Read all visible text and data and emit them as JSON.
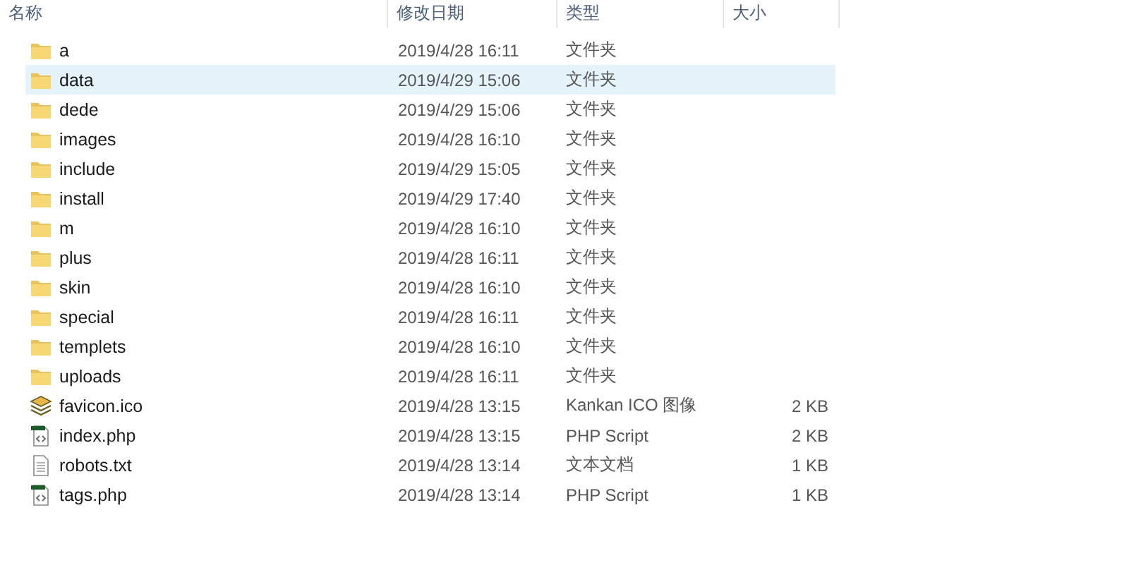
{
  "table": {
    "columns": [
      {
        "label": "名称"
      },
      {
        "label": "修改日期"
      },
      {
        "label": "类型"
      },
      {
        "label": "大小"
      }
    ],
    "rows": [
      {
        "kind": "folder",
        "name": "a",
        "modified": "2019/4/28 16:11",
        "type": "文件夹",
        "selected": false
      },
      {
        "kind": "folder",
        "name": "data",
        "modified": "2019/4/29 15:06",
        "type": "文件夹",
        "selected": true
      },
      {
        "kind": "folder",
        "name": "dede",
        "modified": "2019/4/29 15:06",
        "type": "文件夹",
        "selected": false
      },
      {
        "kind": "folder",
        "name": "images",
        "modified": "2019/4/28 16:10",
        "type": "文件夹",
        "selected": false
      },
      {
        "kind": "folder",
        "name": "include",
        "modified": "2019/4/29 15:05",
        "type": "文件夹",
        "selected": false
      },
      {
        "kind": "folder",
        "name": "install",
        "modified": "2019/4/29 17:40",
        "type": "文件夹",
        "selected": false
      },
      {
        "kind": "folder",
        "name": "m",
        "modified": "2019/4/28 16:10",
        "type": "文件夹",
        "selected": false
      },
      {
        "kind": "folder",
        "name": "plus",
        "modified": "2019/4/28 16:11",
        "type": "文件夹",
        "selected": false
      },
      {
        "kind": "folder",
        "name": "skin",
        "modified": "2019/4/28 16:10",
        "type": "文件夹",
        "selected": false
      },
      {
        "kind": "folder",
        "name": "special",
        "modified": "2019/4/28 16:11",
        "type": "文件夹",
        "selected": false
      },
      {
        "kind": "folder",
        "name": "templets",
        "modified": "2019/4/28 16:10",
        "type": "文件夹",
        "selected": false
      },
      {
        "kind": "folder",
        "name": "uploads",
        "modified": "2019/4/28 16:11",
        "type": "文件夹",
        "selected": false
      },
      {
        "kind": "ico",
        "name": "favicon.ico",
        "modified": "2019/4/28 13:15",
        "type": "Kankan ICO 图像",
        "size": "2 KB",
        "selected": false
      },
      {
        "kind": "php",
        "name": "index.php",
        "modified": "2019/4/28 13:15",
        "type": "PHP Script",
        "size": "2 KB",
        "selected": false
      },
      {
        "kind": "txt",
        "name": "robots.txt",
        "modified": "2019/4/28 13:14",
        "type": "文本文档",
        "size": "1 KB",
        "selected": false
      },
      {
        "kind": "php",
        "name": "tags.php",
        "modified": "2019/4/28 13:14",
        "type": "PHP Script",
        "size": "1 KB",
        "selected": false
      }
    ]
  }
}
